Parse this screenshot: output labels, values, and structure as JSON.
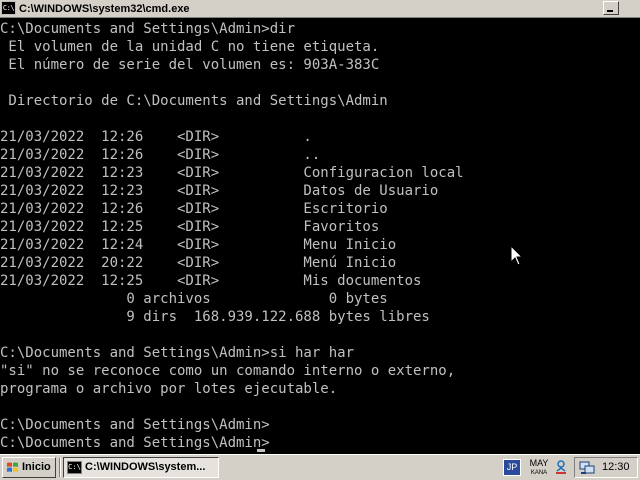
{
  "window": {
    "title": "C:\\WINDOWS\\system32\\cmd.exe",
    "icon": "cmd-icon",
    "icon_text": "C:\\"
  },
  "console": {
    "lines": [
      "C:\\Documents and Settings\\Admin>dir",
      " El volumen de la unidad C no tiene etiqueta.",
      " El número de serie del volumen es: 903A-383C",
      "",
      " Directorio de C:\\Documents and Settings\\Admin",
      "",
      "21/03/2022  12:26    <DIR>          .",
      "21/03/2022  12:26    <DIR>          ..",
      "21/03/2022  12:23    <DIR>          Configuracion local",
      "21/03/2022  12:23    <DIR>          Datos de Usuario",
      "21/03/2022  12:26    <DIR>          Escritorio",
      "21/03/2022  12:25    <DIR>          Favoritos",
      "21/03/2022  12:24    <DIR>          Menu Inicio",
      "21/03/2022  20:22    <DIR>          Menú Inicio",
      "21/03/2022  12:25    <DIR>          Mis documentos",
      "               0 archivos              0 bytes",
      "               9 dirs  168.939.122.688 bytes libres",
      "",
      "C:\\Documents and Settings\\Admin>si har har",
      "\"si\" no se reconoce como un comando interno o externo,",
      "programa o archivo por lotes ejecutable.",
      "",
      "C:\\Documents and Settings\\Admin>",
      "C:\\Documents and Settings\\Admin>"
    ]
  },
  "taskbar": {
    "start_label": "Inicio",
    "task_label": "C:\\WINDOWS\\system...",
    "ime_label": "JP",
    "ime_mode_top": "MAY",
    "ime_mode_bottom": "KANA",
    "clock": "12:30"
  },
  "colors": {
    "console_text": "#c0c0c0",
    "console_bg": "#000000",
    "chrome": "#d4d0c8"
  }
}
